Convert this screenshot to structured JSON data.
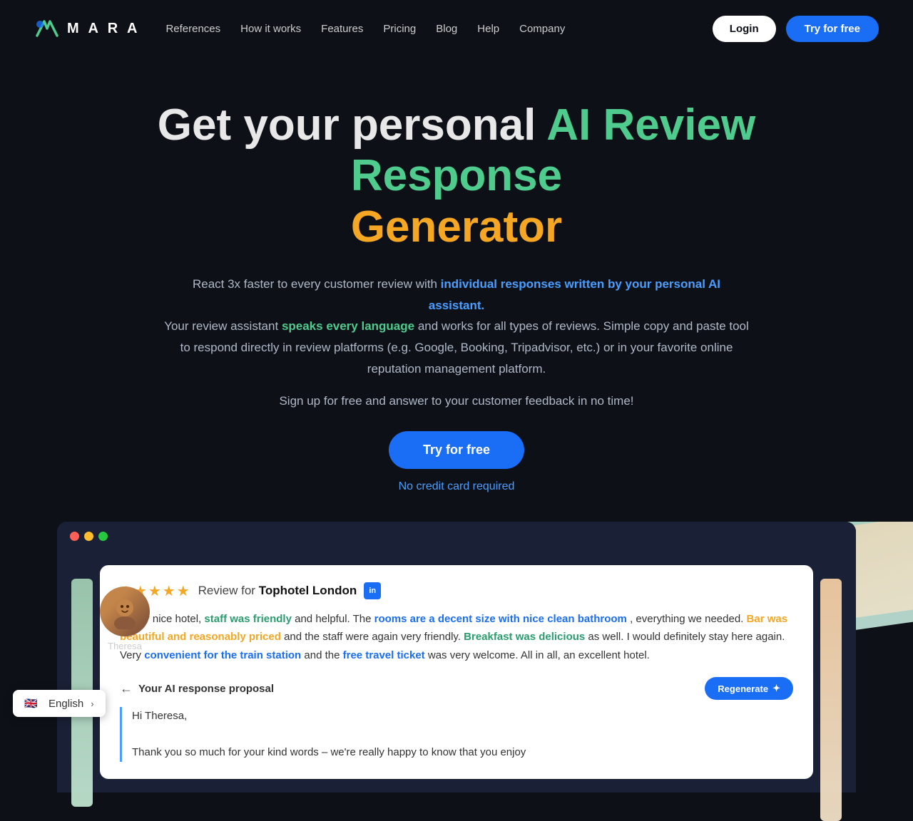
{
  "nav": {
    "logo_text": "M A R A",
    "links": [
      {
        "label": "References",
        "id": "references"
      },
      {
        "label": "How it works",
        "id": "how-it-works"
      },
      {
        "label": "Features",
        "id": "features"
      },
      {
        "label": "Pricing",
        "id": "pricing"
      },
      {
        "label": "Blog",
        "id": "blog"
      },
      {
        "label": "Help",
        "id": "help"
      },
      {
        "label": "Company",
        "id": "company"
      }
    ],
    "login_label": "Login",
    "try_label": "Try for free"
  },
  "hero": {
    "title_plain": "Get your personal",
    "title_highlight": "AI Review Response",
    "title_highlight2": "Generator",
    "sub1_plain1": "React 3x faster to every customer review with",
    "sub1_link": "individual responses written by your personal AI assistant.",
    "sub2_plain1": "Your review assistant",
    "sub2_link": "speaks every language",
    "sub2_plain2": "and works for all types of reviews. Simple copy and paste tool to respond directly in review platforms (e.g. Google, Booking, Tripadvisor, etc.) or in your favorite online reputation management platform.",
    "signup_text": "Sign up for free and answer to your customer feedback in no time!",
    "try_label": "Try for free",
    "no_credit": "No credit card required"
  },
  "demo": {
    "window_dots": [
      "red",
      "yellow",
      "green"
    ],
    "avatar_name": "Theresa",
    "review_stars": "★★★★★",
    "review_for_text": "Review for",
    "hotel_name": "Tophotel London",
    "hotel_badge": "in",
    "review_text_1": "Really nice hotel,",
    "review_hl1": "staff was friendly",
    "review_text_2": "and helpful. The",
    "review_hl2": "rooms are a decent size with nice clean bathroom",
    "review_text_3": ", everything we needed.",
    "review_hl3": "Bar was beautiful and reasonably priced",
    "review_text_4": "and the staff were again very friendly.",
    "review_hl4": "Breakfast was delicious",
    "review_text_5": "as well. I would definitely stay here again. Very",
    "review_hl5": "convenient for the train station",
    "review_text_6": "and the",
    "review_hl6": "free travel ticket",
    "review_text_7": "was very welcome. All in all, an excellent hotel.",
    "ai_label": "Your AI response proposal",
    "regenerate_label": "Regenerate",
    "ai_response_line1": "Hi Theresa,",
    "ai_response_line2": "Thank you so much for your kind words – we're really happy to know that you enjoy"
  },
  "footer": {
    "lang_label": "English",
    "flag_emoji": "🇬🇧"
  }
}
